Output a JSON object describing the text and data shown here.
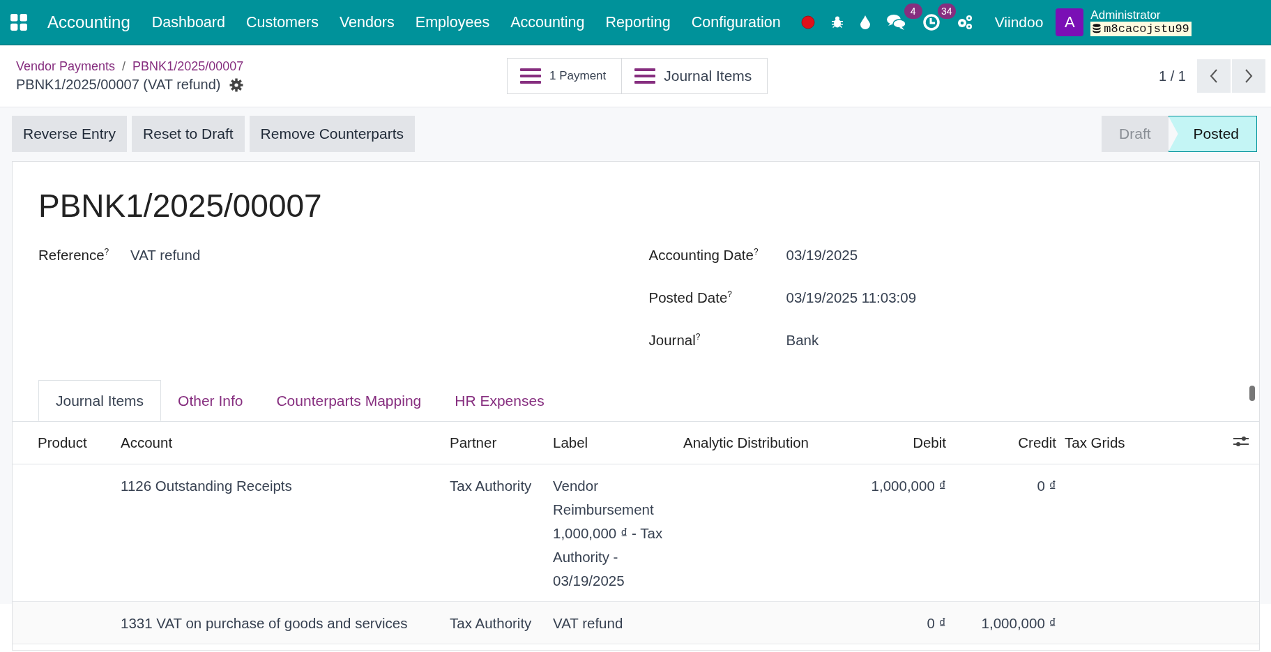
{
  "navbar": {
    "app_name": "Accounting",
    "menu": [
      "Dashboard",
      "Customers",
      "Vendors",
      "Employees",
      "Accounting",
      "Reporting",
      "Configuration"
    ],
    "messages_count": "4",
    "activities_count": "34",
    "company": "Viindoo",
    "avatar_letter": "A",
    "user_name": "Administrator",
    "database": "m8cacojstu99"
  },
  "breadcrumb": {
    "items": [
      "Vendor Payments",
      "PBNK1/2025/00007"
    ],
    "separator": "/",
    "current": "PBNK1/2025/00007 (VAT refund)"
  },
  "smart_buttons": [
    "1 Payment",
    "Journal Items"
  ],
  "pager": {
    "value": "1 / 1"
  },
  "action_buttons": [
    "Reverse Entry",
    "Reset to Draft",
    "Remove Counterparts"
  ],
  "status_steps": [
    {
      "label": "Draft",
      "selected": false
    },
    {
      "label": "Posted",
      "selected": true
    }
  ],
  "record": {
    "title": "PBNK1/2025/00007",
    "left_fields": [
      {
        "label": "Reference",
        "help_mark": "?",
        "value": "VAT refund"
      }
    ],
    "right_fields": [
      {
        "label": "Accounting Date",
        "help_mark": "?",
        "value": "03/19/2025"
      },
      {
        "label": "Posted Date",
        "help_mark": "?",
        "value": "03/19/2025 11:03:09"
      },
      {
        "label": "Journal",
        "help_mark": "?",
        "value": "Bank"
      }
    ]
  },
  "tabs": [
    {
      "label": "Journal Items",
      "selected": true
    },
    {
      "label": "Other Info",
      "selected": false
    },
    {
      "label": "Counterparts Mapping",
      "selected": false
    },
    {
      "label": "HR Expenses",
      "selected": false
    }
  ],
  "table": {
    "columns": [
      "Product",
      "Account",
      "Partner",
      "Label",
      "Analytic Distribution",
      "Debit",
      "Credit",
      "Tax Grids"
    ],
    "rows": [
      {
        "account": "1126 Outstanding Receipts",
        "partner": "Tax Authority",
        "label": "Vendor Reimbursement 1,000,000 ₫ - Tax Authority - 03/19/2025",
        "debit": "1,000,000 ₫",
        "credit": "0 ₫"
      },
      {
        "account": "1331 VAT on purchase of goods and services",
        "partner": "Tax Authority",
        "label": "VAT refund",
        "debit": "0 ₫",
        "credit": "1,000,000 ₫"
      }
    ]
  }
}
